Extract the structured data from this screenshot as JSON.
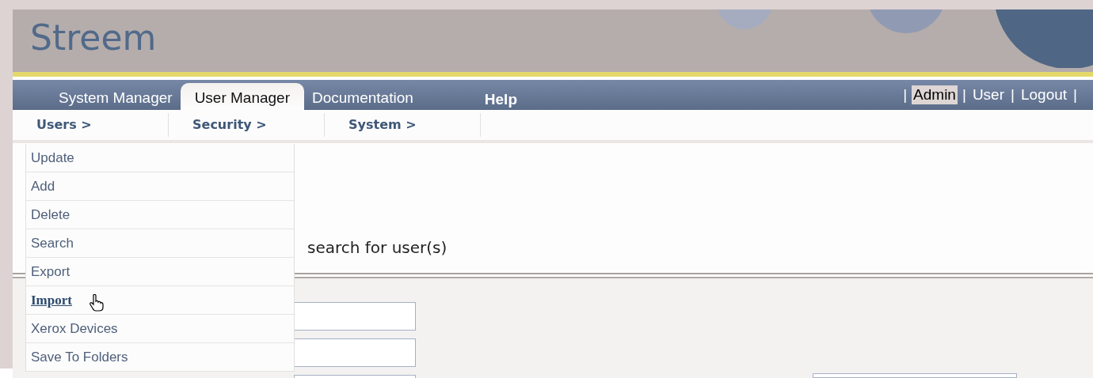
{
  "header": {
    "title": "Streem"
  },
  "tabs": [
    {
      "label": "System Manager",
      "selected": false,
      "kind": "tab"
    },
    {
      "label": "User Manager",
      "selected": true,
      "kind": "tab"
    },
    {
      "label": "Documentation",
      "selected": false,
      "kind": "tab"
    },
    {
      "label": "Help",
      "selected": false,
      "kind": "bold"
    }
  ],
  "account_links": [
    {
      "label": "Admin",
      "selected": true
    },
    {
      "label": "User",
      "selected": false
    },
    {
      "label": "Logout",
      "selected": false
    }
  ],
  "account_separator": "|",
  "subnav": [
    {
      "label": "Users >"
    },
    {
      "label": "Security >"
    },
    {
      "label": "System >"
    }
  ],
  "menu": [
    {
      "label": "Update",
      "hovered": false
    },
    {
      "label": "Add",
      "hovered": false
    },
    {
      "label": "Delete",
      "hovered": false
    },
    {
      "label": "Search",
      "hovered": false
    },
    {
      "label": "Export",
      "hovered": false
    },
    {
      "label": "Import",
      "hovered": true
    },
    {
      "label": "Xerox Devices",
      "hovered": false
    },
    {
      "label": "Save To Folders",
      "hovered": false
    }
  ],
  "content": {
    "instruction": "search for user(s)"
  }
}
